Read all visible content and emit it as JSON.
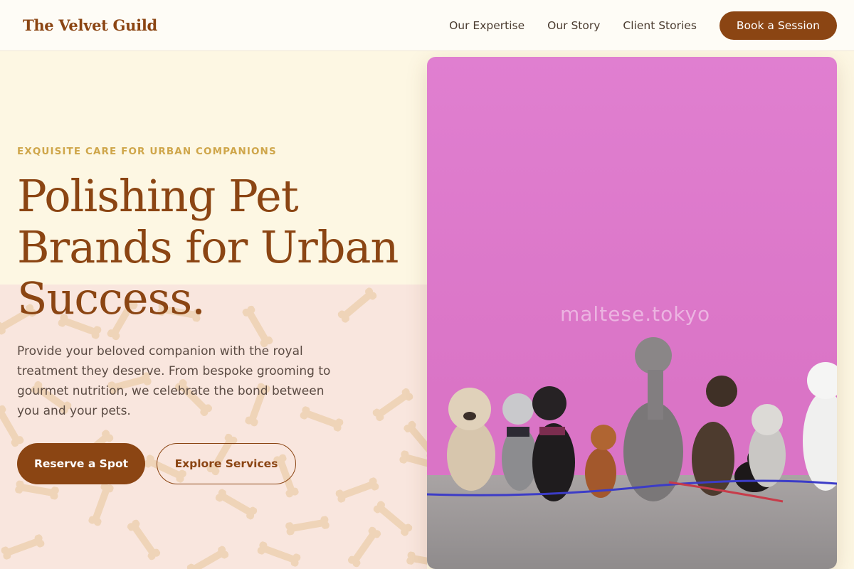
{
  "nav": {
    "brand": "The Velvet Guild",
    "links": [
      "Our Expertise",
      "Our Story",
      "Client Stories"
    ],
    "cta": "Book a Session"
  },
  "hero": {
    "eyebrow": "EXQUISITE CARE FOR URBAN COMPANIONS",
    "headline": "Polishing Pet Brands for Urban Success.",
    "description": "Provide your beloved companion with the royal treatment they deserve. From bespoke grooming to gourmet nutrition, we celebrate the bond between you and your pets.",
    "primary_button": "Reserve a Spot",
    "secondary_button": "Explore Services"
  },
  "photo": {
    "watermark": "maltese.tokyo"
  },
  "colors": {
    "accent": "#8b4513",
    "eyebrow": "#cfa64a",
    "background": "#fdf7e3",
    "wall": "#e07fd0"
  }
}
